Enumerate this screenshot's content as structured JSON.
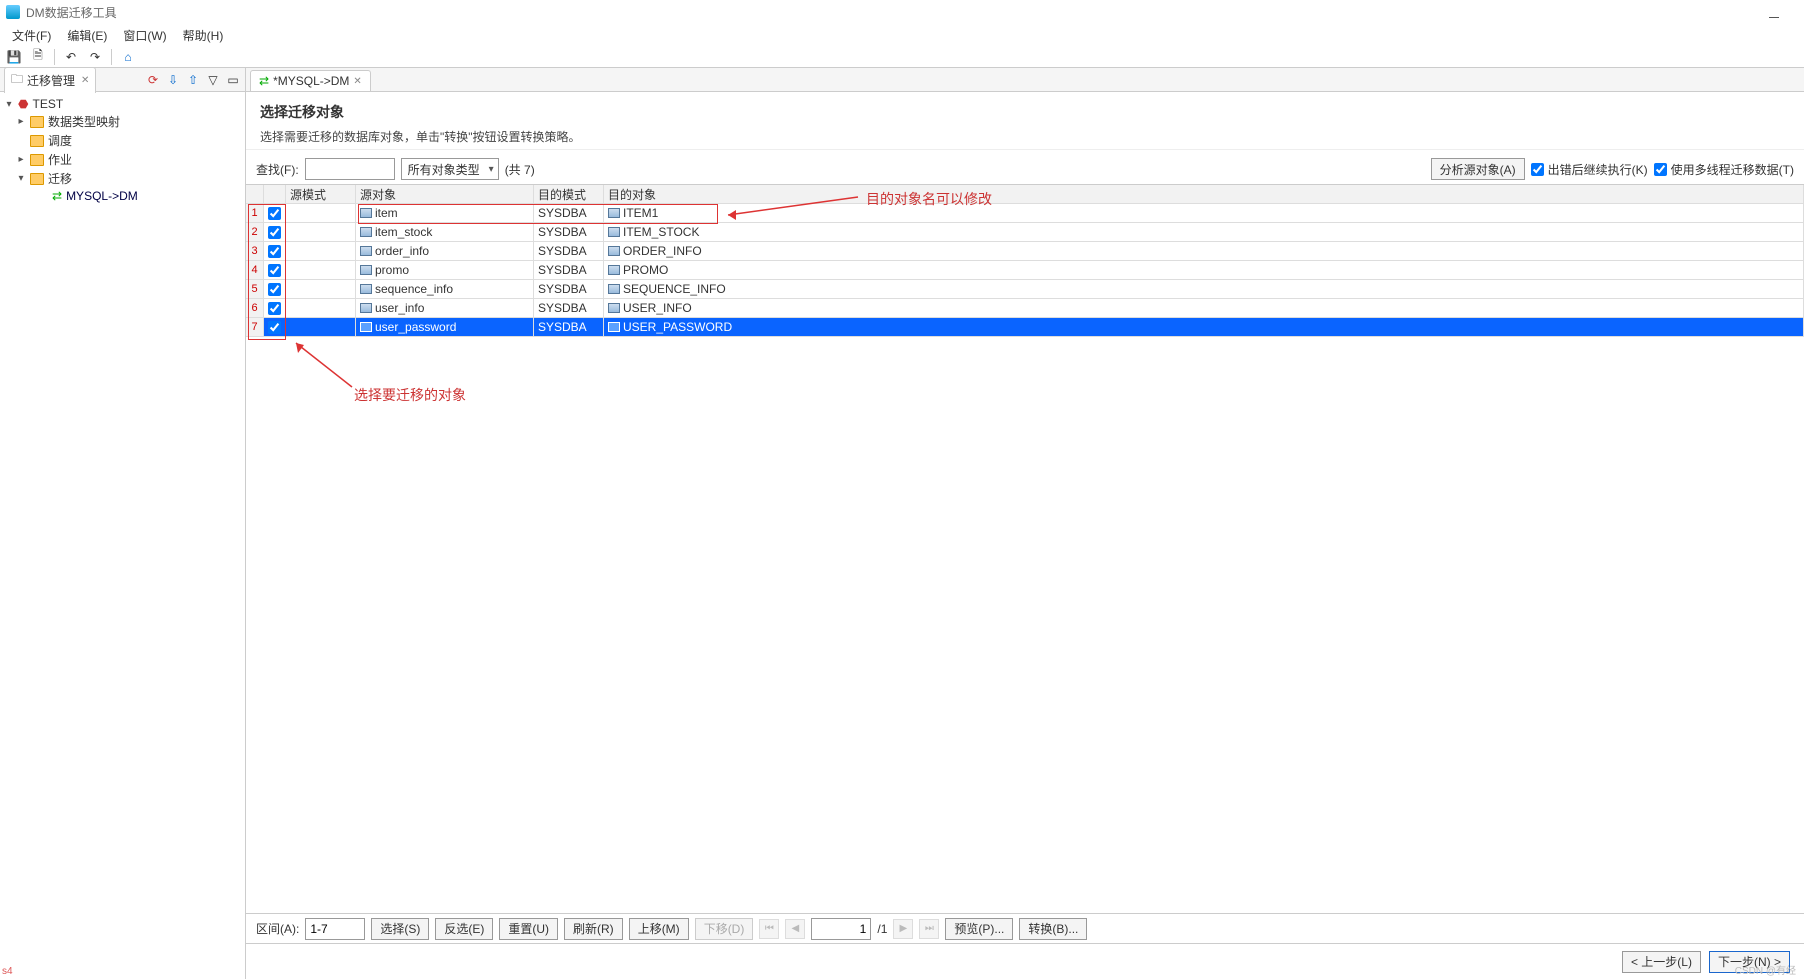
{
  "app": {
    "title": "DM数据迁移工具"
  },
  "menu": {
    "file": "文件(F)",
    "edit": "编辑(E)",
    "window": "窗口(W)",
    "help": "帮助(H)"
  },
  "leftPanel": {
    "tabTitle": "迁移管理",
    "tree": {
      "root": "TEST",
      "nodes": [
        "数据类型映射",
        "调度",
        "作业",
        "迁移"
      ],
      "migrationChild": "MYSQL->DM"
    }
  },
  "editor": {
    "tabTitle": "*MYSQL->DM"
  },
  "page": {
    "title": "选择迁移对象",
    "desc": "选择需要迁移的数据库对象，单击\"转换\"按钮设置转换策略。"
  },
  "filter": {
    "findLabel": "查找(F):",
    "combo": "所有对象类型",
    "countText": "(共 7)",
    "analyzeBtn": "分析源对象(A)",
    "continueOnError": "出错后继续执行(K)",
    "useMultithread": "使用多线程迁移数据(T)"
  },
  "columns": {
    "srcSchema": "源模式",
    "srcObj": "源对象",
    "dstSchema": "目的模式",
    "dstObj": "目的对象"
  },
  "rows": [
    {
      "n": 1,
      "src": "item",
      "dstSchema": "SYSDBA",
      "dst": "ITEM1",
      "sel": false
    },
    {
      "n": 2,
      "src": "item_stock",
      "dstSchema": "SYSDBA",
      "dst": "ITEM_STOCK",
      "sel": false
    },
    {
      "n": 3,
      "src": "order_info",
      "dstSchema": "SYSDBA",
      "dst": "ORDER_INFO",
      "sel": false
    },
    {
      "n": 4,
      "src": "promo",
      "dstSchema": "SYSDBA",
      "dst": "PROMO",
      "sel": false
    },
    {
      "n": 5,
      "src": "sequence_info",
      "dstSchema": "SYSDBA",
      "dst": "SEQUENCE_INFO",
      "sel": false
    },
    {
      "n": 6,
      "src": "user_info",
      "dstSchema": "SYSDBA",
      "dst": "USER_INFO",
      "sel": false
    },
    {
      "n": 7,
      "src": "user_password",
      "dstSchema": "SYSDBA",
      "dst": "USER_PASSWORD",
      "sel": true
    }
  ],
  "annotations": {
    "rightNote": "目的对象名可以修改",
    "bottomNote": "选择要迁移的对象"
  },
  "pager": {
    "rangeLabel": "区间(A):",
    "rangeValue": "1-7",
    "select": "选择(S)",
    "invert": "反选(E)",
    "reset": "重置(U)",
    "refresh": "刷新(R)",
    "moveUp": "上移(M)",
    "moveDown": "下移(D)",
    "page": "1",
    "totalPages": "/1",
    "preview": "预览(P)...",
    "transform": "转换(B)..."
  },
  "footer": {
    "prev": "< 上一步(L)",
    "next": "下一步(N) >"
  },
  "watermark": "CSDN @有经"
}
